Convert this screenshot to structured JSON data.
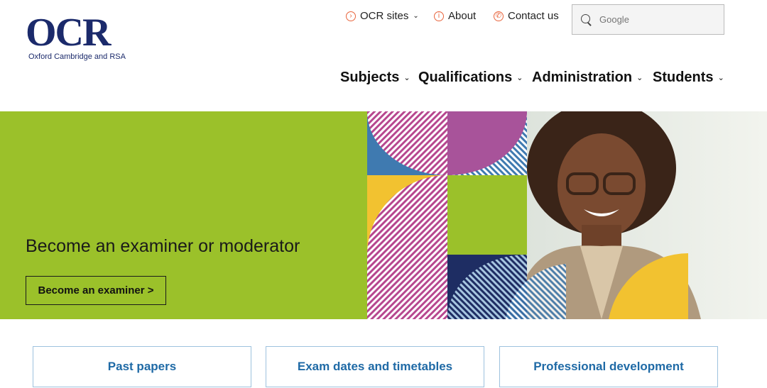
{
  "brand": {
    "logo_text": "OCR",
    "logo_subtitle": "Oxford Cambridge and RSA",
    "primary_color": "#1b2a6b",
    "accent_color": "#e8643c"
  },
  "utility_nav": {
    "ocr_sites": "OCR sites",
    "about": "About",
    "contact": "Contact us"
  },
  "search": {
    "placeholder": "Google"
  },
  "main_nav": {
    "subjects": "Subjects",
    "qualifications": "Qualifications",
    "administration": "Administration",
    "students": "Students"
  },
  "hero": {
    "title": "Become an examiner or moderator",
    "button": "Become an examiner >",
    "background_color": "#9bc12a"
  },
  "quick_links": {
    "past_papers": "Past papers",
    "exam_dates": "Exam dates and timetables",
    "professional_development": "Professional development",
    "link_color": "#1f6aa6"
  }
}
